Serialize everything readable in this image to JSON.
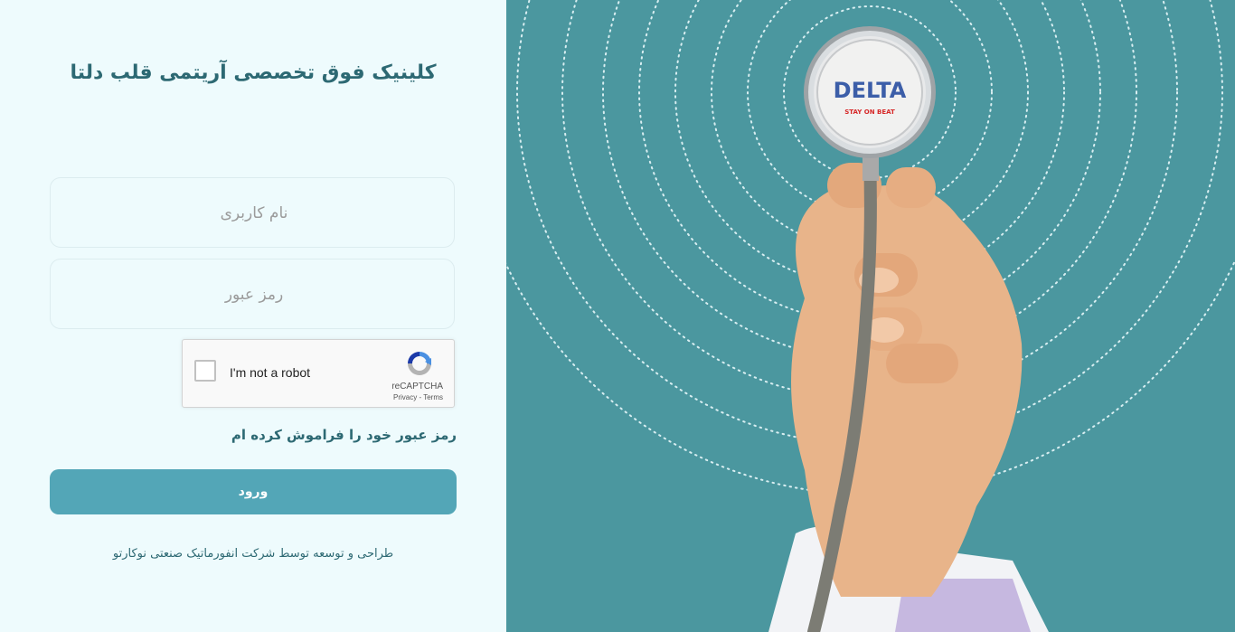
{
  "header": {
    "title": "کلینیک فوق تخصصی آریتمی قلب دلتا"
  },
  "form": {
    "username_placeholder": "نام کاربری",
    "password_placeholder": "رمز عبور",
    "forgot_password": "رمز عبور خود را فراموش کرده ام",
    "login_button": "ورود"
  },
  "captcha": {
    "label": "I'm not a robot",
    "brand": "reCAPTCHA",
    "links": "Privacy - Terms"
  },
  "footer": {
    "credit": "طراحی و توسعه توسط شرکت انفورماتیک صنعتی نوکارتو"
  },
  "hero": {
    "logo_text": "DELTA",
    "logo_tagline": "STAY ON BEAT",
    "background_color": "#4b979f"
  },
  "colors": {
    "accent": "#53a6b7",
    "title": "#2d6973",
    "panel_background": "#eefbfd"
  }
}
